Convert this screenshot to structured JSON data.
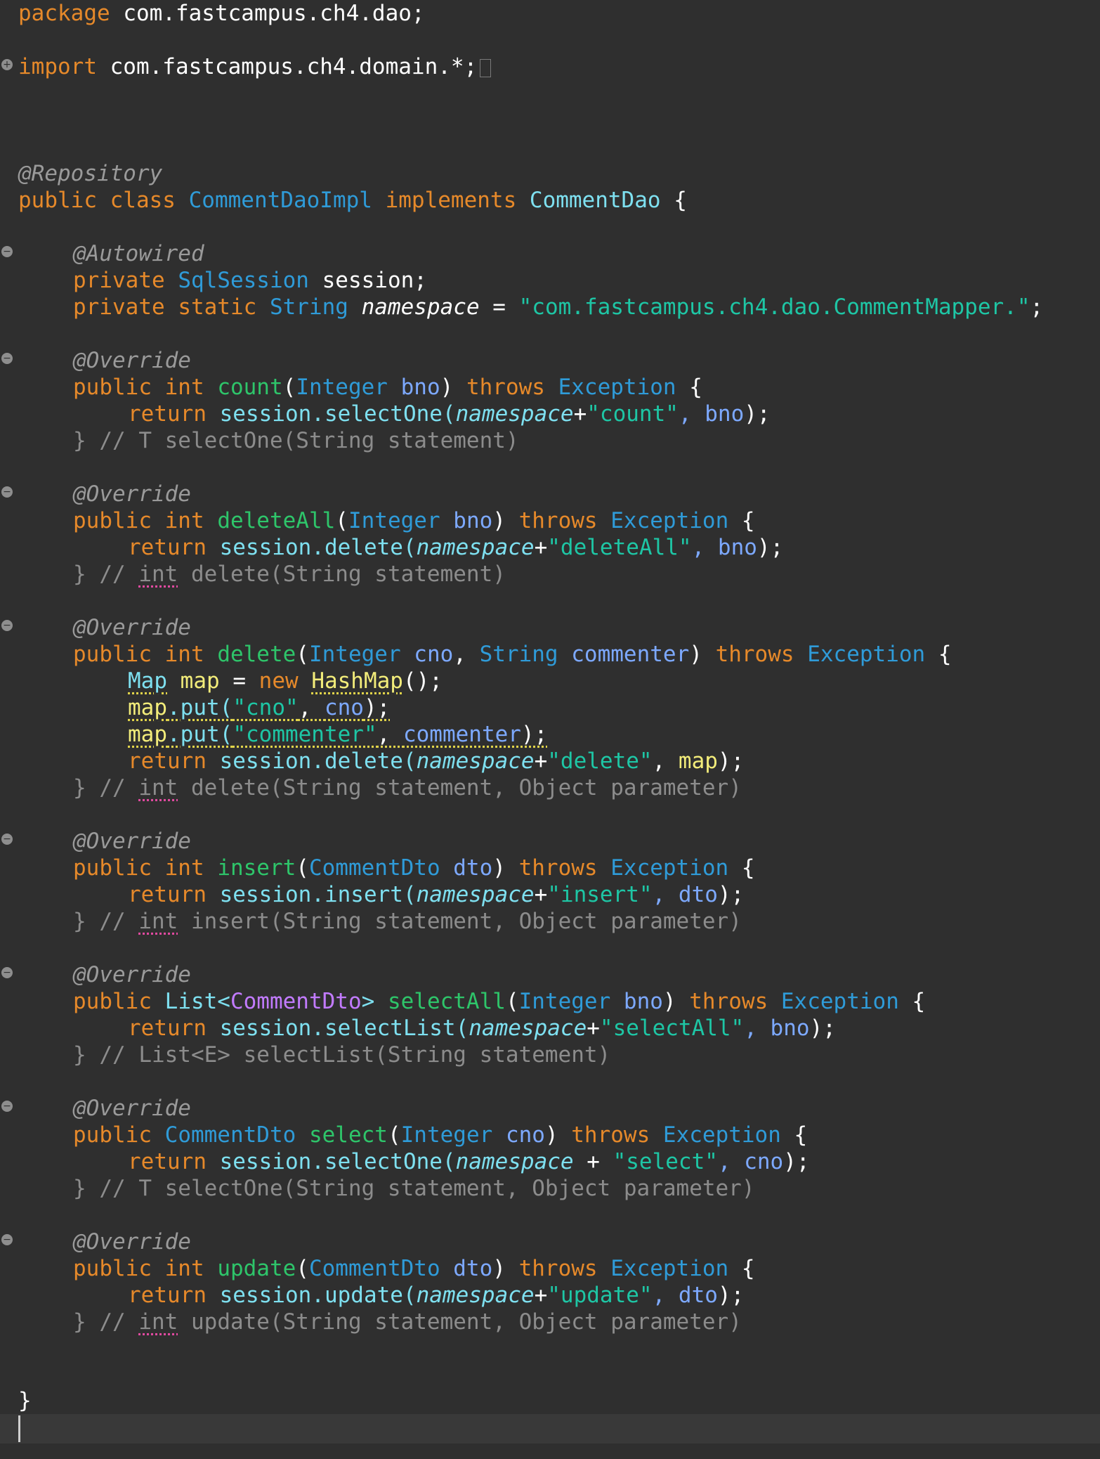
{
  "code": {
    "line_package": "package",
    "pkg_name": " com.fastcampus.ch4.dao;",
    "line_import_kw": "import",
    "import_name": " com.fastcampus.ch4.domain.*;",
    "ann_repository": "@Repository",
    "class_decl": {
      "public": "public",
      "class": " class ",
      "name": "CommentDaoImpl",
      "implements": " implements ",
      "iface": "CommentDao",
      "brace": " {"
    },
    "ann_autowired": "@Autowired",
    "field1": {
      "private": "private",
      "type": " SqlSession",
      "name": " session;"
    },
    "field2": {
      "private": "private",
      "static": " static",
      "type": " String",
      "name": "namespace",
      "eq": " = ",
      "value": "\"com.fastcampus.ch4.dao.CommentMapper.\"",
      "semi": ";"
    },
    "override": "@Override",
    "methods": [
      {
        "sig_prefix": "public int ",
        "name": "count",
        "open": "(",
        "ptype": "Integer",
        "pname": " bno",
        "close": ") ",
        "throws": "throws",
        "exc": " Exception",
        "brace": " {",
        "ret": "return",
        "sess": " session",
        "call": ".selectOne(",
        "ns": "namespace",
        "plus": "+",
        "str": "\"count\"",
        "arg": ", bno",
        "end": ");",
        "comment": "} // T selectOne(String statement)"
      },
      {
        "sig_prefix": "public int ",
        "name": "deleteAll",
        "open": "(",
        "ptype": "Integer",
        "pname": " bno",
        "close": ") ",
        "throws": "throws",
        "exc": " Exception",
        "brace": " {",
        "ret": "return",
        "sess": " session",
        "call": ".delete(",
        "ns": "namespace",
        "plus": "+",
        "str": "\"deleteAll\"",
        "arg": ", bno",
        "end": ");",
        "comment_a": "} // ",
        "comment_int": "int",
        "comment_b": " delete(String statement)"
      },
      {
        "sig_prefix": "public int ",
        "name": "insert",
        "open": "(",
        "ptype": "CommentDto",
        "pname": " dto",
        "close": ") ",
        "throws": "throws",
        "exc": " Exception",
        "brace": " {",
        "ret": "return",
        "sess": " session",
        "call": ".insert(",
        "ns": "namespace",
        "plus": "+",
        "str": "\"insert\"",
        "arg": ", dto",
        "end": ");",
        "comment_a": "} // ",
        "comment_int": "int",
        "comment_b": " insert(String statement, Object parameter)"
      },
      {
        "sig_prefix": "public ",
        "ret_list": "List<",
        "ret_generic": "CommentDto",
        "ret_close": "> ",
        "name": "selectAll",
        "open": "(",
        "ptype": "Integer",
        "pname": " bno",
        "close": ") ",
        "throws": "throws",
        "exc": " Exception",
        "brace": " {",
        "ret": "return",
        "sess": " session",
        "call": ".selectList(",
        "ns": "namespace",
        "plus": "+",
        "str": "\"selectAll\"",
        "arg": ", bno",
        "end": ");",
        "comment": "} // List<E> selectList(String statement)"
      },
      {
        "sig_prefix": "public ",
        "ret_type": "CommentDto",
        "name": " select",
        "open": "(",
        "ptype": "Integer",
        "pname": " cno",
        "close": ") ",
        "throws": "throws",
        "exc": " Exception",
        "brace": " {",
        "ret": "return",
        "sess": " session",
        "call": ".selectOne(",
        "ns": "namespace",
        "plus": " + ",
        "str": "\"select\"",
        "arg": ", cno",
        "end": ");",
        "comment": "} // T selectOne(String statement, Object parameter)"
      },
      {
        "sig_prefix": "public int ",
        "name": "update",
        "open": "(",
        "ptype": "CommentDto",
        "pname": " dto",
        "close": ") ",
        "throws": "throws",
        "exc": " Exception",
        "brace": " {",
        "ret": "return",
        "sess": " session",
        "call": ".update(",
        "ns": "namespace",
        "plus": "+",
        "str": "\"update\"",
        "arg": ", dto",
        "end": ");",
        "comment_a": "} // ",
        "comment_int": "int",
        "comment_b": " update(String statement, Object parameter)"
      }
    ],
    "delete_method": {
      "sig_prefix": "public int ",
      "name": "delete",
      "open": "(",
      "p1type": "Integer",
      "p1name": " cno",
      "comma": ", ",
      "p2type": "String",
      "p2name": " commenter",
      "close": ") ",
      "throws": "throws",
      "exc": " Exception",
      "brace": " {",
      "map_type": "Map",
      "map_var": " map",
      "eq": " = ",
      "new": "new ",
      "hashmap": "HashMap",
      "paren": "();",
      "put1_a": "map",
      "put1_b": ".put(",
      "put1_key": "\"cno\"",
      "put1_sep": ", ",
      "put1_val": "cno",
      "put1_end": ");",
      "put2_a": "map",
      "put2_b": ".put(",
      "put2_key": "\"commenter\"",
      "put2_sep": ", ",
      "put2_val": "commenter",
      "put2_end": ");",
      "ret": "return",
      "sess": " session",
      "call": ".delete(",
      "ns": "namespace",
      "plus": "+",
      "str": "\"delete\"",
      "comma2": ", ",
      "arg": "map",
      "end": ");",
      "comment_a": "} // ",
      "comment_int": "int",
      "comment_b": " delete(String statement, Object parameter)"
    },
    "closing_brace": "}"
  }
}
